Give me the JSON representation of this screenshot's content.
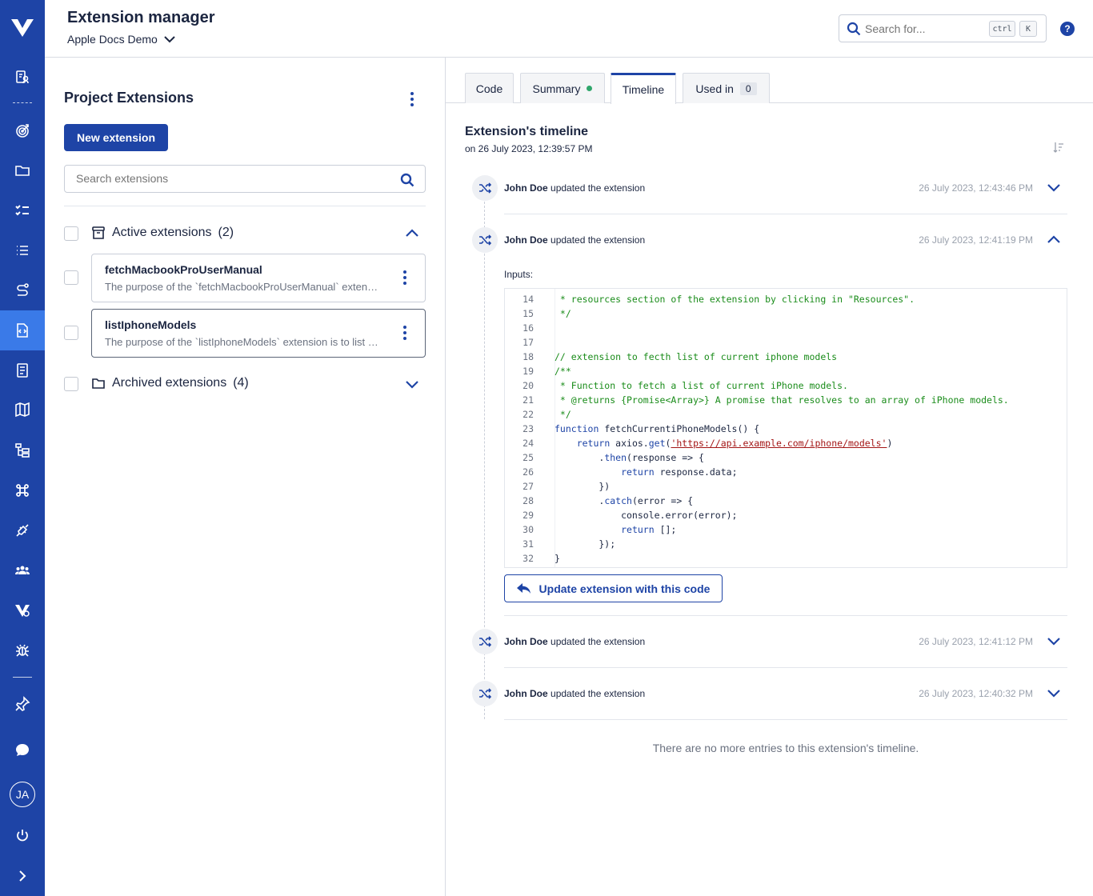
{
  "header": {
    "title": "Extension manager",
    "project": "Apple Docs Demo",
    "search_placeholder": "Search for...",
    "shortcut_key1": "ctrl",
    "shortcut_key2": "K",
    "help": "?"
  },
  "sidebar": {
    "avatar_initials": "JA",
    "items": [
      "people-search-icon",
      "target-icon",
      "folder-icon",
      "checklist-icon",
      "list-icon",
      "route-icon",
      "extension-icon",
      "report-icon",
      "map-icon",
      "hierarchy-icon",
      "command-icon",
      "plug-icon",
      "team-icon",
      "settings-logo-icon",
      "bug-icon",
      "pin-icon",
      "chat-icon",
      "power-icon",
      "expand-icon"
    ],
    "active_item": "extension-icon"
  },
  "left_panel": {
    "title": "Project Extensions",
    "new_button": "New extension",
    "search_placeholder": "Search extensions",
    "active_group": {
      "label": "Active extensions",
      "count": "(2)"
    },
    "archived_group": {
      "label": "Archived extensions",
      "count": "(4)"
    },
    "extensions": [
      {
        "name": "fetchMacbookProUserManual",
        "description": "The purpose of the `fetchMacbookProUserManual` extension is to fetch the user manual for the MacBook Pro"
      },
      {
        "name": "listIphoneModels",
        "description": "The purpose of the `listIphoneModels` extension is to list current iPhone models"
      }
    ]
  },
  "right_panel": {
    "tabs": [
      {
        "label": "Code"
      },
      {
        "label": "Summary"
      },
      {
        "label": "Timeline"
      },
      {
        "label": "Used in",
        "count": "0"
      }
    ],
    "active_tab": "Timeline",
    "timeline_title": "Extension's timeline",
    "timeline_subtitle": "on 26 July 2023, 12:39:57 PM",
    "entries": [
      {
        "user": "John Doe",
        "action": "updated the extension",
        "date": "26 July 2023, 12:43:46 PM"
      },
      {
        "user": "John Doe",
        "action": "updated the extension",
        "date": "26 July 2023, 12:41:19 PM"
      },
      {
        "user": "John Doe",
        "action": "updated the extension",
        "date": "26 July 2023, 12:41:12 PM"
      },
      {
        "user": "John Doe",
        "action": "updated the extension",
        "date": "26 July 2023, 12:40:32 PM"
      }
    ],
    "inputs_label": "Inputs:",
    "code_lines": [
      {
        "n": "14",
        "t": " * resources section of the extension by clicking in \"Resources\"."
      },
      {
        "n": "15",
        "t": " */"
      },
      {
        "n": "16",
        "t": ""
      },
      {
        "n": "17",
        "t": ""
      },
      {
        "n": "18",
        "t": "// extension to fecth list of current iphone models"
      },
      {
        "n": "19",
        "t": "/**"
      },
      {
        "n": "20",
        "t": " * Function to fetch a list of current iPhone models."
      },
      {
        "n": "21",
        "t": " * @returns {Promise<Array>} A promise that resolves to an array of iPhone models."
      },
      {
        "n": "22",
        "t": " */"
      },
      {
        "n": "23",
        "t": "function fetchCurrentiPhoneModels() {"
      },
      {
        "n": "24",
        "t": "    return axios.get('https://api.example.com/iphone/models')"
      },
      {
        "n": "25",
        "t": "        .then(response => {"
      },
      {
        "n": "26",
        "t": "            return response.data;"
      },
      {
        "n": "27",
        "t": "        })"
      },
      {
        "n": "28",
        "t": "        .catch(error => {"
      },
      {
        "n": "29",
        "t": "            console.error(error);"
      },
      {
        "n": "30",
        "t": "            return [];"
      },
      {
        "n": "31",
        "t": "        });"
      },
      {
        "n": "32",
        "t": "}"
      }
    ],
    "update_button": "Update extension with this code",
    "end_message": "There are no more entries to this extension's timeline."
  },
  "colors": {
    "brand": "#1e44a6",
    "sidebar_active": "#3a7ae8",
    "success_dot": "#2fa66b",
    "comment": "#1a8c1a",
    "string": "#a31515"
  }
}
